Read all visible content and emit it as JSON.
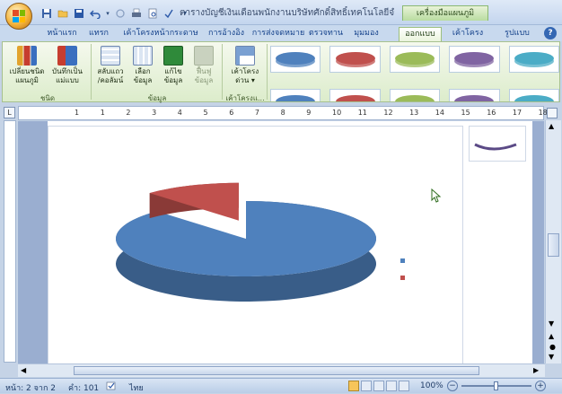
{
  "window": {
    "title": "ตารางบัญชีเงินเดือนพนักงานบริษัทศักดิ์สิทธิ์เทคโนโลยีจำ...M",
    "context_tab": "เครื่องมือแผนภูมิ"
  },
  "tabs": [
    "หน้าแรก",
    "แทรก",
    "เค้าโครงหน้ากระดาษ",
    "การอ้างอิง",
    "การส่งจดหมาย",
    "ตรวจทาน",
    "มุมมอง",
    "ออกแบบ",
    "เค้าโครง",
    "รูปแบบ"
  ],
  "active_tab": "ออกแบบ",
  "help": "?",
  "ribbon": {
    "groups": [
      {
        "label": "ชนิด",
        "buttons": [
          {
            "label1": "เปลี่ยนชนิด",
            "label2": "แผนภูมิ"
          },
          {
            "label1": "บันทึกเป็น",
            "label2": "แม่แบบ"
          }
        ]
      },
      {
        "label": "ข้อมูล",
        "buttons": [
          {
            "label1": "สลับแถว",
            "label2": "/คอลัมน์"
          },
          {
            "label1": "เลือก",
            "label2": "ข้อมูล"
          },
          {
            "label1": "แก้ไข",
            "label2": "ข้อมูล"
          },
          {
            "label1": "ฟื้นฟู",
            "label2": "ข้อมูล"
          }
        ]
      },
      {
        "label": "เค้าโครงแ...",
        "buttons": [
          {
            "label1": "เค้าโครง",
            "label2": "ด่วน ▾"
          }
        ]
      }
    ],
    "style_colors": [
      "#4f81bd",
      "#c0504d",
      "#9bbb59",
      "#8064a2",
      "#4bacc6"
    ]
  },
  "ruler": {
    "numbers": [
      "1",
      "1",
      "2",
      "3",
      "4",
      "5",
      "6",
      "7",
      "8",
      "9",
      "10",
      "11",
      "12",
      "13",
      "14",
      "15",
      "16",
      "17",
      "18"
    ]
  },
  "chart_data": {
    "type": "pie",
    "title": "",
    "subtitle": "",
    "labels": [
      "",
      ""
    ],
    "values": [
      88,
      12
    ],
    "colors": [
      "#4f81bd",
      "#c0504d"
    ],
    "style": "3d-exploded"
  },
  "statusbar": {
    "page": "หน้า: 2 จาก 2",
    "words": "คำ: 101",
    "language": "ไทย",
    "zoom": "100%"
  }
}
